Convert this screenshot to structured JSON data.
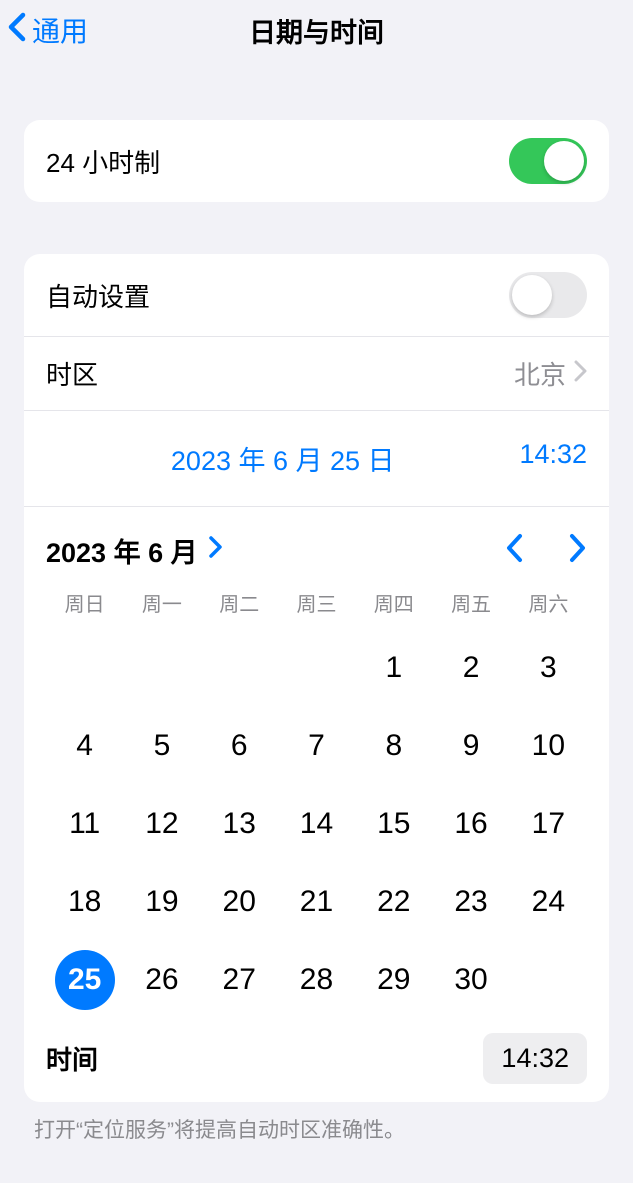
{
  "header": {
    "back_label": "通用",
    "title": "日期与时间"
  },
  "twenty_four_hour": {
    "label": "24 小时制",
    "on": true
  },
  "auto_set": {
    "label": "自动设置",
    "on": false
  },
  "timezone": {
    "label": "时区",
    "value": "北京"
  },
  "selected_date_label": "2023 年 6 月 25 日",
  "selected_time": "14:32",
  "calendar": {
    "month_label": "2023 年 6 月",
    "weekdays": [
      "周日",
      "周一",
      "周二",
      "周三",
      "周四",
      "周五",
      "周六"
    ],
    "blanks": 4,
    "days": 30,
    "selected": 25
  },
  "time_section": {
    "label": "时间",
    "value": "14:32"
  },
  "footer": "打开“定位服务”将提高自动时区准确性。"
}
